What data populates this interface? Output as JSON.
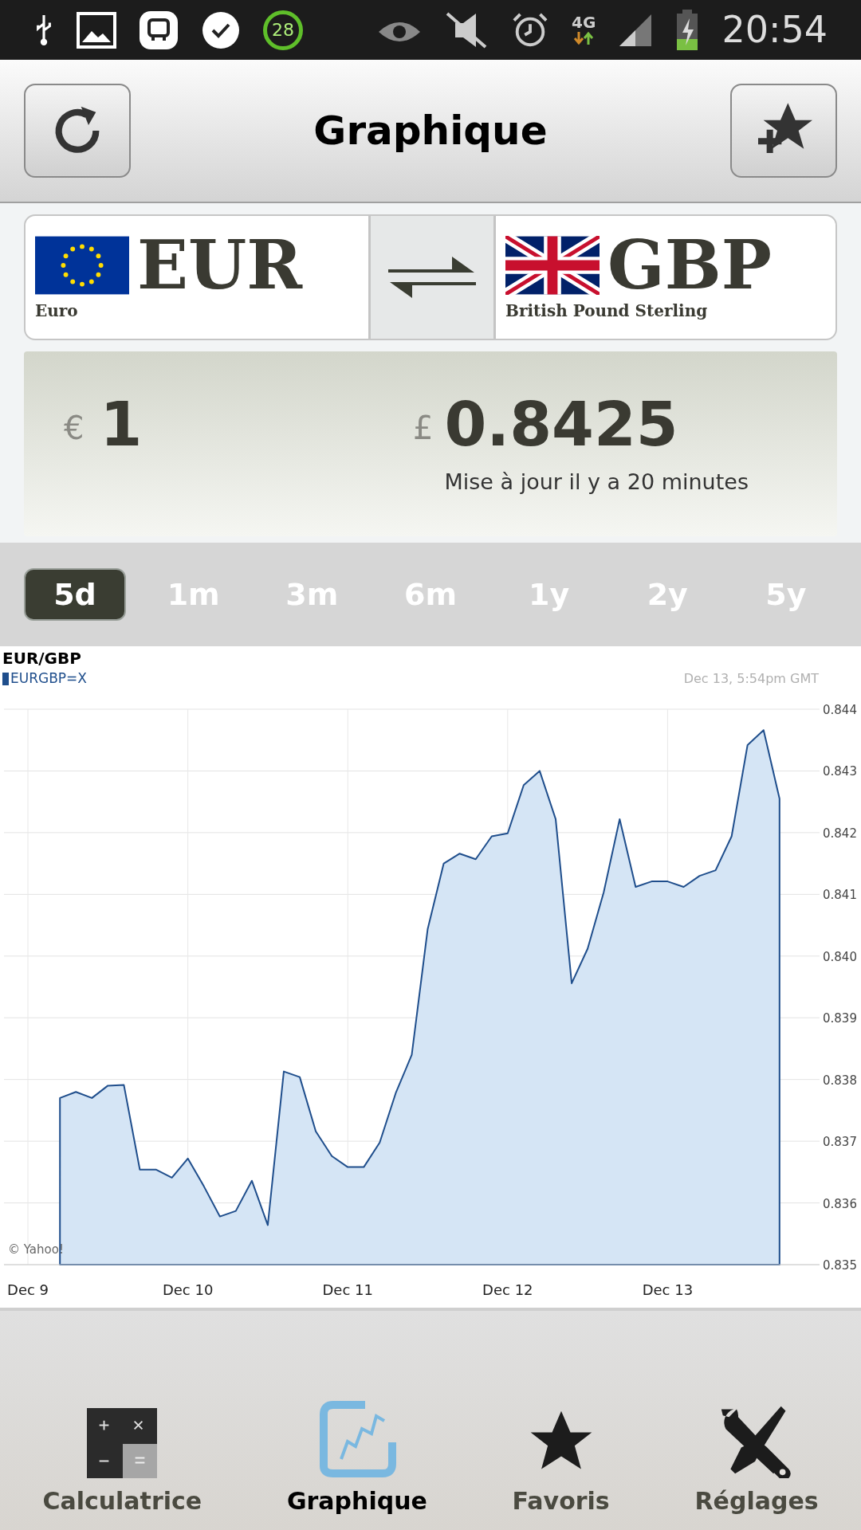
{
  "status_bar": {
    "notification_badge": "28",
    "network": "4G",
    "time": "20:54"
  },
  "title_bar": {
    "title": "Graphique"
  },
  "currency_pair": {
    "from": {
      "code": "EUR",
      "name": "Euro"
    },
    "to": {
      "code": "GBP",
      "name": "British Pound Sterling"
    }
  },
  "conversion": {
    "from_symbol": "€",
    "from_amount": "1",
    "to_symbol": "£",
    "to_amount": "0.8425",
    "updated": "Mise à jour il y a 20 minutes"
  },
  "periods": [
    {
      "label": "5d",
      "selected": true
    },
    {
      "label": "1m",
      "selected": false
    },
    {
      "label": "3m",
      "selected": false
    },
    {
      "label": "6m",
      "selected": false
    },
    {
      "label": "1y",
      "selected": false
    },
    {
      "label": "2y",
      "selected": false
    },
    {
      "label": "5y",
      "selected": false
    }
  ],
  "chart": {
    "timestamp": "Dec 13, 5:54pm GMT",
    "credit": "© Yahoo!",
    "chart_data": {
      "type": "area",
      "grid": true,
      "title": "EUR/GBP",
      "ylim": [
        0.835,
        0.844
      ],
      "categories": [
        "Dec 9",
        null,
        null,
        null,
        null,
        null,
        null,
        null,
        null,
        null,
        "Dec 10",
        null,
        null,
        null,
        null,
        null,
        null,
        null,
        null,
        null,
        "Dec 11",
        null,
        null,
        null,
        null,
        null,
        null,
        null,
        null,
        null,
        "Dec 12",
        null,
        null,
        null,
        null,
        null,
        null,
        null,
        null,
        null,
        "Dec 13",
        null,
        null,
        null,
        null,
        null,
        null,
        null,
        null,
        null
      ],
      "yticks": [
        {
          "value": 0.835,
          "label": "0.835"
        },
        {
          "value": 0.836,
          "label": "0.836"
        },
        {
          "value": 0.837,
          "label": "0.837"
        },
        {
          "value": 0.838,
          "label": "0.838"
        },
        {
          "value": 0.839,
          "label": "0.839"
        },
        {
          "value": 0.84,
          "label": "0.840"
        },
        {
          "value": 0.841,
          "label": "0.841"
        },
        {
          "value": 0.842,
          "label": "0.842"
        },
        {
          "value": 0.843,
          "label": "0.843"
        },
        {
          "value": 0.844,
          "label": "0.844"
        }
      ],
      "series": [
        {
          "name": "EURGBP=X",
          "color": "#1f4e8c",
          "values": [
            null,
            null,
            0.8377,
            0.8378,
            0.8377,
            0.8379,
            0.83791,
            0.83654,
            0.83654,
            0.83641,
            0.83672,
            0.83627,
            0.83578,
            0.83587,
            0.83636,
            0.83564,
            0.83813,
            0.83804,
            0.83716,
            0.83676,
            0.83658,
            0.83658,
            0.83698,
            0.83778,
            0.8384,
            0.84044,
            0.8415,
            0.84166,
            0.84157,
            0.84194,
            0.84199,
            0.84277,
            0.843,
            0.84222,
            0.83956,
            0.84012,
            0.84103,
            0.84222,
            0.84112,
            0.84121,
            0.84121,
            0.84112,
            0.8413,
            0.84139,
            0.84194,
            0.84342,
            0.84366,
            0.84255,
            null,
            null
          ]
        }
      ]
    }
  },
  "bottom_nav": [
    {
      "label": "Calculatrice",
      "kind": "calculator",
      "selected": false
    },
    {
      "label": "Graphique",
      "kind": "chart",
      "selected": true
    },
    {
      "label": "Favoris",
      "kind": "star",
      "selected": false
    },
    {
      "label": "Réglages",
      "kind": "tools",
      "selected": false
    }
  ]
}
